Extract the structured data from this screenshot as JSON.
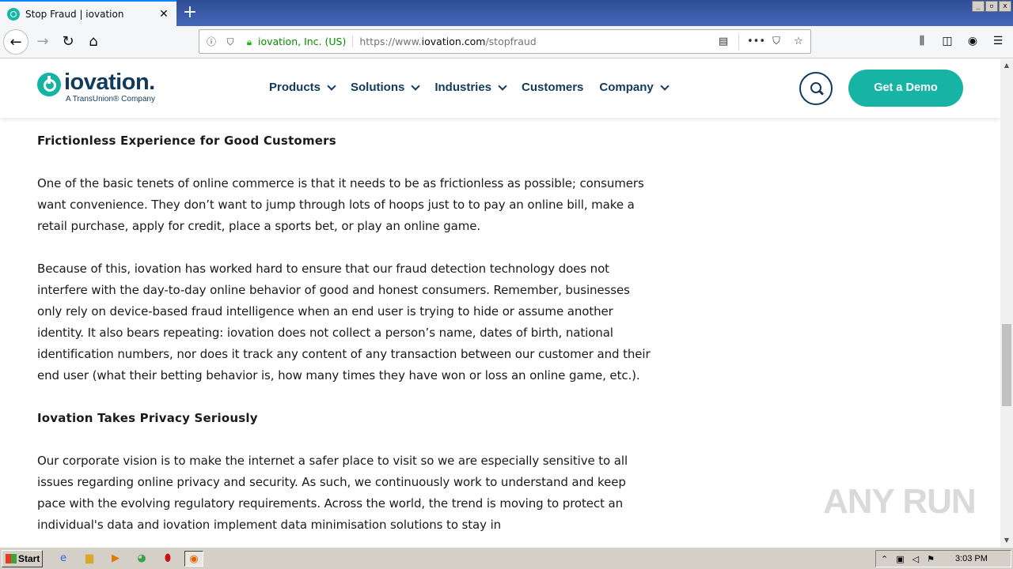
{
  "browser": {
    "tab_title": "Stop Fraud | iovation",
    "identity": "iovation, Inc. (US)",
    "url_prefix": "https://www.",
    "url_domain": "iovation.com",
    "url_path": "/stopfraud"
  },
  "site": {
    "logo_word": "iovation.",
    "logo_sub": "A TransUnion® Company",
    "menu": [
      "Products",
      "Solutions",
      "Industries",
      "Customers",
      "Company"
    ],
    "cta": "Get a Demo"
  },
  "article": {
    "h1": "Frictionless Experience for Good Customers",
    "p1": "One of the basic tenets of online commerce is that it needs to be as frictionless as possible; consumers want convenience. They don’t want to jump through lots of hoops just to to pay an online bill, make a retail purchase, apply for credit, place a sports bet, or play an online game.",
    "p2": "Because of this, iovation has worked hard to ensure that our fraud detection technology does not interfere with the day-to-day online behavior of good and honest consumers. Remember, businesses only rely on device-based fraud intelligence when an end user is trying to hide or assume another identity. It also bears repeating: iovation does not collect a person’s name, dates of birth, national identification numbers, nor does it track any content of any transaction between our customer and their end user (what their betting behavior is, how many times they have won or loss an online game, etc.).",
    "h2": "Iovation Takes Privacy Seriously",
    "p3": "Our corporate vision is to make the internet a safer place to visit so we are especially sensitive to all issues regarding online privacy and security. As such, we continuously work to understand and keep pace with the evolving regulatory requirements. Across the world, the trend is moving to protect an individual's data and iovation implement data minimisation solutions to stay in"
  },
  "watermark": "ANY RUN",
  "taskbar": {
    "start": "Start",
    "clock": "3:03 PM"
  }
}
